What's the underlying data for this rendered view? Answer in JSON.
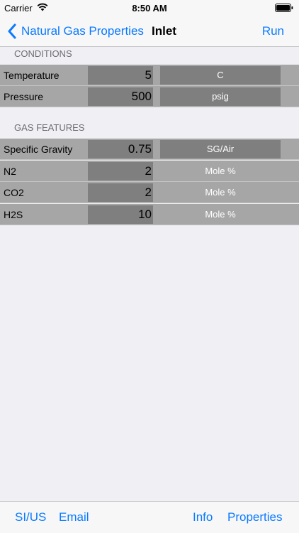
{
  "status_bar": {
    "carrier": "Carrier",
    "time": "8:50 AM"
  },
  "nav": {
    "back_label": "Natural Gas Properties",
    "title": "Inlet",
    "run_label": "Run"
  },
  "conditions": {
    "header": "CONDITIONS",
    "rows": [
      {
        "label": "Temperature",
        "value": "5",
        "unit": "C"
      },
      {
        "label": "Pressure",
        "value": "500",
        "unit": "psig"
      }
    ]
  },
  "gas_features": {
    "header": "GAS FEATURES",
    "rows": [
      {
        "label": "Specific Gravity",
        "value": "0.75",
        "unit": "SG/Air"
      },
      {
        "label": "N2",
        "value": "2",
        "unit": "Mole %"
      },
      {
        "label": "CO2",
        "value": "2",
        "unit": "Mole %"
      },
      {
        "label": "H2S",
        "value": "10",
        "unit": "Mole %"
      }
    ]
  },
  "toolbar": {
    "si_us": "SI/US",
    "email": "Email",
    "info": "Info",
    "properties": "Properties"
  },
  "colors": {
    "accent": "#0a7aff",
    "row_bg": "#a6a6a6",
    "field_bg": "#7f7f7f",
    "page_bg": "#efeff4"
  }
}
